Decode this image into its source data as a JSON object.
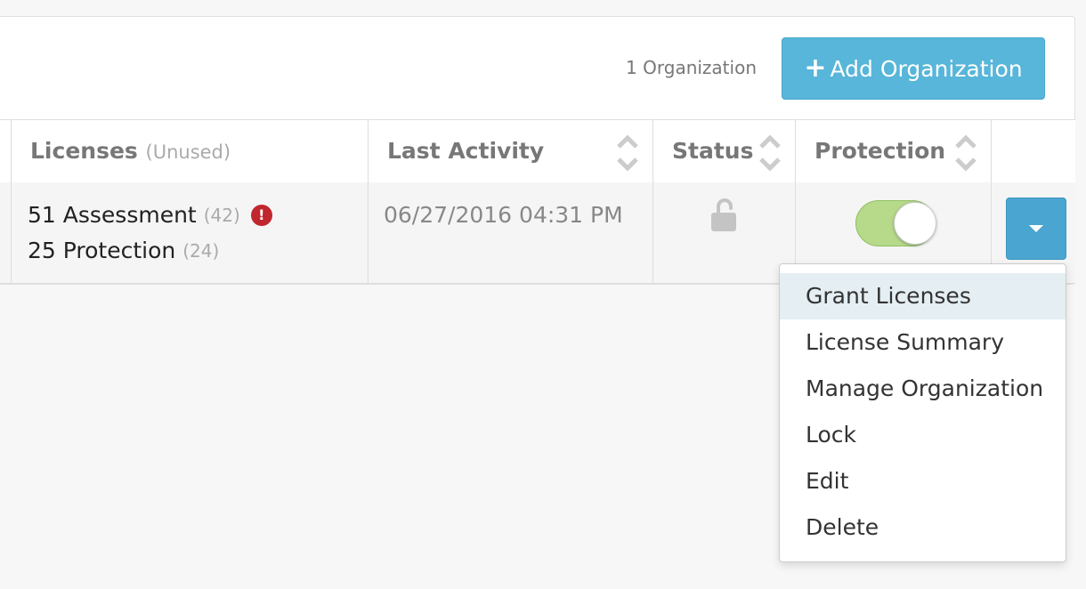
{
  "header": {
    "org_count": "1 Organization",
    "add_button_label": "Add Organization"
  },
  "table": {
    "columns": {
      "licenses": "Licenses",
      "licenses_sub": "(Unused)",
      "last_activity": "Last Activity",
      "status": "Status",
      "protection": "Protection"
    },
    "row": {
      "assessment": "51 Assessment",
      "assessment_unused": "(42)",
      "protection": "25 Protection",
      "protection_unused": "(24)",
      "warning_glyph": "!",
      "last_activity": "06/27/2016 04:31 PM",
      "status_icon": "unlock-icon",
      "protection_enabled": true
    }
  },
  "actions_menu": {
    "items": [
      "Grant Licenses",
      "License Summary",
      "Manage Organization",
      "Lock",
      "Edit",
      "Delete"
    ],
    "active_index": 0
  },
  "colors": {
    "primary_button": "#57b6d9",
    "warning": "#c0262d",
    "toggle_on": "#b6d98a"
  }
}
